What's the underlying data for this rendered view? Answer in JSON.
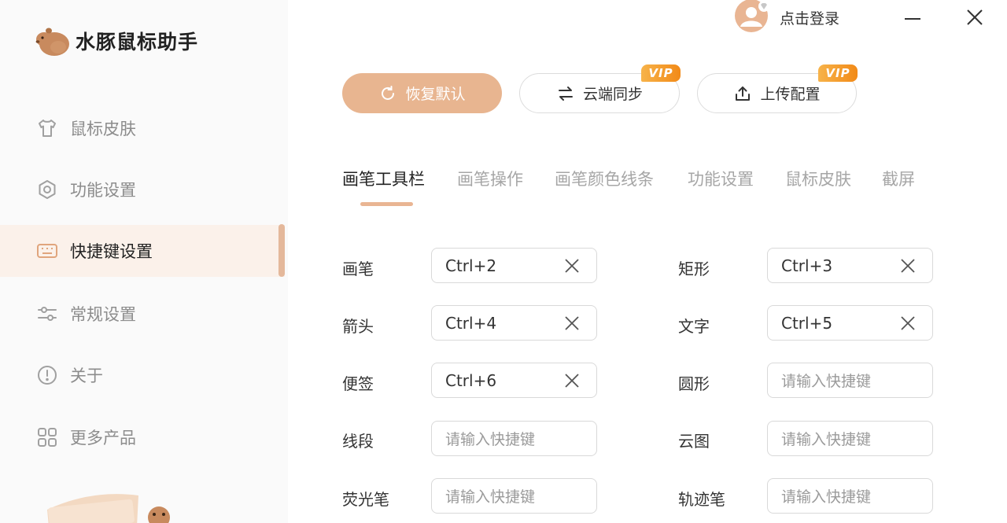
{
  "app": {
    "title": "水豚鼠标助手"
  },
  "header": {
    "login_text": "点击登录"
  },
  "sidebar": {
    "items": [
      {
        "label": "鼠标皮肤",
        "icon": "tshirt-icon"
      },
      {
        "label": "功能设置",
        "icon": "hexagon-settings-icon"
      },
      {
        "label": "快捷键设置",
        "icon": "keyboard-icon",
        "active": true
      },
      {
        "label": "常规设置",
        "icon": "sliders-icon"
      },
      {
        "label": "关于",
        "icon": "info-icon"
      },
      {
        "label": "更多产品",
        "icon": "grid-icon"
      }
    ]
  },
  "actions": {
    "restore_label": "恢复默认",
    "sync_label": "云端同步",
    "upload_label": "上传配置",
    "vip_badge": "VIP"
  },
  "tabs": [
    {
      "label": "画笔工具栏",
      "active": true
    },
    {
      "label": "画笔操作"
    },
    {
      "label": "画笔颜色线条"
    },
    {
      "label": "功能设置"
    },
    {
      "label": "鼠标皮肤"
    },
    {
      "label": "截屏"
    }
  ],
  "shortcuts": {
    "placeholder": "请输入快捷键",
    "rows": [
      {
        "label": "画笔",
        "value": "Ctrl+2"
      },
      {
        "label": "矩形",
        "value": "Ctrl+3"
      },
      {
        "label": "箭头",
        "value": "Ctrl+4"
      },
      {
        "label": "文字",
        "value": "Ctrl+5"
      },
      {
        "label": "便签",
        "value": "Ctrl+6"
      },
      {
        "label": "圆形",
        "value": ""
      },
      {
        "label": "线段",
        "value": ""
      },
      {
        "label": "云图",
        "value": ""
      },
      {
        "label": "荧光笔",
        "value": ""
      },
      {
        "label": "轨迹笔",
        "value": ""
      }
    ]
  },
  "colors": {
    "accent": "#e8b590",
    "active_bg": "#fbf1ea",
    "vip_start": "#f7b34a",
    "vip_end": "#f28a17"
  }
}
